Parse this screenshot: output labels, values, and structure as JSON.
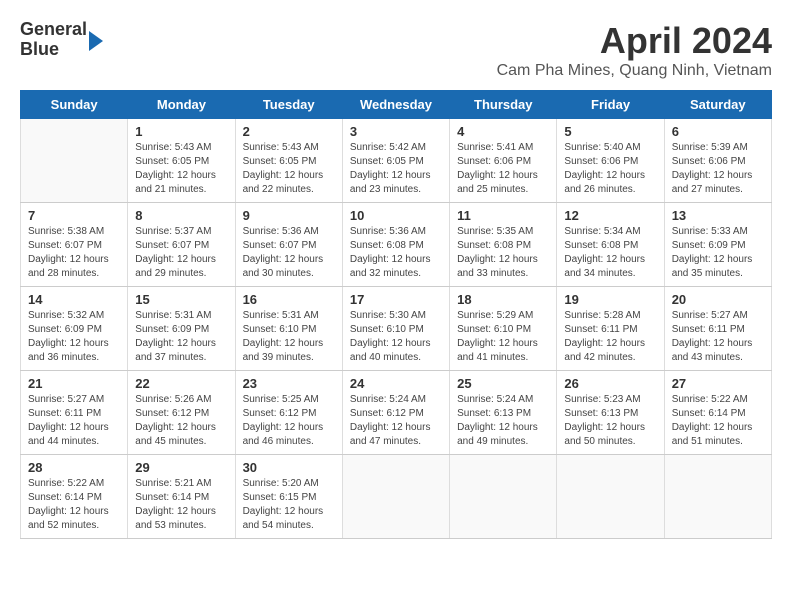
{
  "header": {
    "logo_line1": "General",
    "logo_line2": "Blue",
    "title": "April 2024",
    "subtitle": "Cam Pha Mines, Quang Ninh, Vietnam"
  },
  "days_of_week": [
    "Sunday",
    "Monday",
    "Tuesday",
    "Wednesday",
    "Thursday",
    "Friday",
    "Saturday"
  ],
  "weeks": [
    [
      {
        "date": "",
        "info": ""
      },
      {
        "date": "1",
        "info": "Sunrise: 5:43 AM\nSunset: 6:05 PM\nDaylight: 12 hours\nand 21 minutes."
      },
      {
        "date": "2",
        "info": "Sunrise: 5:43 AM\nSunset: 6:05 PM\nDaylight: 12 hours\nand 22 minutes."
      },
      {
        "date": "3",
        "info": "Sunrise: 5:42 AM\nSunset: 6:05 PM\nDaylight: 12 hours\nand 23 minutes."
      },
      {
        "date": "4",
        "info": "Sunrise: 5:41 AM\nSunset: 6:06 PM\nDaylight: 12 hours\nand 25 minutes."
      },
      {
        "date": "5",
        "info": "Sunrise: 5:40 AM\nSunset: 6:06 PM\nDaylight: 12 hours\nand 26 minutes."
      },
      {
        "date": "6",
        "info": "Sunrise: 5:39 AM\nSunset: 6:06 PM\nDaylight: 12 hours\nand 27 minutes."
      }
    ],
    [
      {
        "date": "7",
        "info": "Sunrise: 5:38 AM\nSunset: 6:07 PM\nDaylight: 12 hours\nand 28 minutes."
      },
      {
        "date": "8",
        "info": "Sunrise: 5:37 AM\nSunset: 6:07 PM\nDaylight: 12 hours\nand 29 minutes."
      },
      {
        "date": "9",
        "info": "Sunrise: 5:36 AM\nSunset: 6:07 PM\nDaylight: 12 hours\nand 30 minutes."
      },
      {
        "date": "10",
        "info": "Sunrise: 5:36 AM\nSunset: 6:08 PM\nDaylight: 12 hours\nand 32 minutes."
      },
      {
        "date": "11",
        "info": "Sunrise: 5:35 AM\nSunset: 6:08 PM\nDaylight: 12 hours\nand 33 minutes."
      },
      {
        "date": "12",
        "info": "Sunrise: 5:34 AM\nSunset: 6:08 PM\nDaylight: 12 hours\nand 34 minutes."
      },
      {
        "date": "13",
        "info": "Sunrise: 5:33 AM\nSunset: 6:09 PM\nDaylight: 12 hours\nand 35 minutes."
      }
    ],
    [
      {
        "date": "14",
        "info": "Sunrise: 5:32 AM\nSunset: 6:09 PM\nDaylight: 12 hours\nand 36 minutes."
      },
      {
        "date": "15",
        "info": "Sunrise: 5:31 AM\nSunset: 6:09 PM\nDaylight: 12 hours\nand 37 minutes."
      },
      {
        "date": "16",
        "info": "Sunrise: 5:31 AM\nSunset: 6:10 PM\nDaylight: 12 hours\nand 39 minutes."
      },
      {
        "date": "17",
        "info": "Sunrise: 5:30 AM\nSunset: 6:10 PM\nDaylight: 12 hours\nand 40 minutes."
      },
      {
        "date": "18",
        "info": "Sunrise: 5:29 AM\nSunset: 6:10 PM\nDaylight: 12 hours\nand 41 minutes."
      },
      {
        "date": "19",
        "info": "Sunrise: 5:28 AM\nSunset: 6:11 PM\nDaylight: 12 hours\nand 42 minutes."
      },
      {
        "date": "20",
        "info": "Sunrise: 5:27 AM\nSunset: 6:11 PM\nDaylight: 12 hours\nand 43 minutes."
      }
    ],
    [
      {
        "date": "21",
        "info": "Sunrise: 5:27 AM\nSunset: 6:11 PM\nDaylight: 12 hours\nand 44 minutes."
      },
      {
        "date": "22",
        "info": "Sunrise: 5:26 AM\nSunset: 6:12 PM\nDaylight: 12 hours\nand 45 minutes."
      },
      {
        "date": "23",
        "info": "Sunrise: 5:25 AM\nSunset: 6:12 PM\nDaylight: 12 hours\nand 46 minutes."
      },
      {
        "date": "24",
        "info": "Sunrise: 5:24 AM\nSunset: 6:12 PM\nDaylight: 12 hours\nand 47 minutes."
      },
      {
        "date": "25",
        "info": "Sunrise: 5:24 AM\nSunset: 6:13 PM\nDaylight: 12 hours\nand 49 minutes."
      },
      {
        "date": "26",
        "info": "Sunrise: 5:23 AM\nSunset: 6:13 PM\nDaylight: 12 hours\nand 50 minutes."
      },
      {
        "date": "27",
        "info": "Sunrise: 5:22 AM\nSunset: 6:14 PM\nDaylight: 12 hours\nand 51 minutes."
      }
    ],
    [
      {
        "date": "28",
        "info": "Sunrise: 5:22 AM\nSunset: 6:14 PM\nDaylight: 12 hours\nand 52 minutes."
      },
      {
        "date": "29",
        "info": "Sunrise: 5:21 AM\nSunset: 6:14 PM\nDaylight: 12 hours\nand 53 minutes."
      },
      {
        "date": "30",
        "info": "Sunrise: 5:20 AM\nSunset: 6:15 PM\nDaylight: 12 hours\nand 54 minutes."
      },
      {
        "date": "",
        "info": ""
      },
      {
        "date": "",
        "info": ""
      },
      {
        "date": "",
        "info": ""
      },
      {
        "date": "",
        "info": ""
      }
    ]
  ]
}
